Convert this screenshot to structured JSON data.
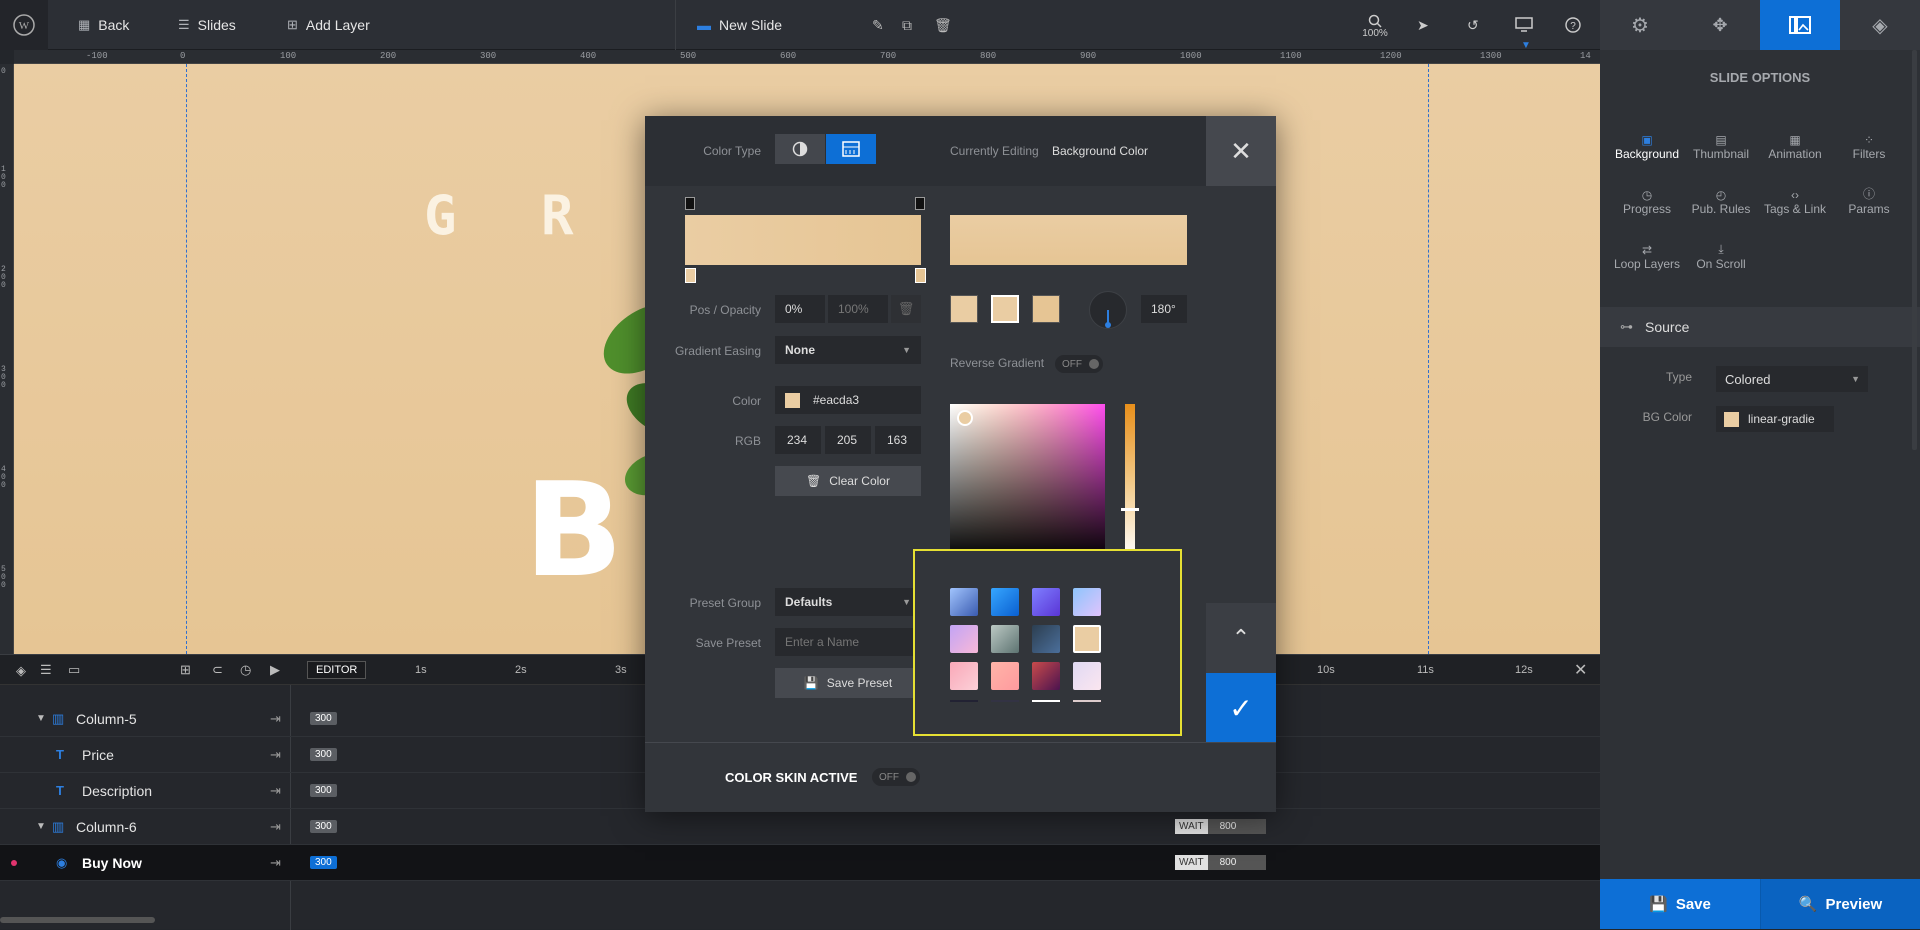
{
  "topbar": {
    "back": "Back",
    "slides": "Slides",
    "add_layer": "Add Layer",
    "slide_name": "New Slide",
    "zoom": "100%"
  },
  "ruler": {
    "h_labels": [
      "-100",
      "0",
      "100",
      "200",
      "300",
      "400",
      "500",
      "600",
      "700",
      "800",
      "900",
      "1000",
      "1100",
      "1200",
      "1300",
      "14"
    ],
    "v_labels": [
      "0",
      "1 0 0",
      "2 0 0",
      "3 0 0",
      "4 0 0",
      "5 0 0"
    ]
  },
  "canvas": {
    "heading": "G R O W",
    "big_text": "B A"
  },
  "timeline": {
    "editor": "EDITOR",
    "ticks": [
      "1s",
      "2s",
      "3s",
      "10s",
      "11s",
      "12s"
    ],
    "layers": [
      {
        "name": "Column-5",
        "badge": "300"
      },
      {
        "name": "Price",
        "badge": "300"
      },
      {
        "name": "Description",
        "badge": "300"
      },
      {
        "name": "Column-6",
        "badge": "300",
        "wait": "WAIT",
        "dur": "800"
      },
      {
        "name": "Buy Now",
        "badge": "300",
        "wait": "WAIT",
        "dur": "800"
      }
    ]
  },
  "sidebar": {
    "title": "SLIDE OPTIONS",
    "options": [
      {
        "label": "Background",
        "icon": "image-icon"
      },
      {
        "label": "Thumbnail",
        "icon": "thumbnail-icon"
      },
      {
        "label": "Animation",
        "icon": "film-icon"
      },
      {
        "label": "Filters",
        "icon": "filters-icon"
      },
      {
        "label": "Progress",
        "icon": "stopwatch-icon"
      },
      {
        "label": "Pub. Rules",
        "icon": "clock-icon"
      },
      {
        "label": "Tags & Link",
        "icon": "code-icon"
      },
      {
        "label": "Params",
        "icon": "info-icon"
      },
      {
        "label": "Loop Layers",
        "icon": "loop-icon"
      },
      {
        "label": "On Scroll",
        "icon": "scroll-icon"
      }
    ],
    "source_title": "Source",
    "type_label": "Type",
    "type_value": "Colored",
    "bgcolor_label": "BG Color",
    "bgcolor_value": "linear-gradie"
  },
  "buttons": {
    "save": "Save",
    "preview": "Preview"
  },
  "modal": {
    "color_type_label": "Color Type",
    "currently_editing_label": "Currently Editing",
    "currently_editing_value": "Background Color",
    "pos_opacity_label": "Pos / Opacity",
    "pos_value": "0%",
    "opacity_value": "100%",
    "gradient_easing_label": "Gradient Easing",
    "gradient_easing_value": "None",
    "reverse_gradient_label": "Reverse Gradient",
    "reverse_toggle": "OFF",
    "angle": "180°",
    "color_label": "Color",
    "color_hex": "#eacda3",
    "rgb_label": "RGB",
    "r": "234",
    "g": "205",
    "b": "163",
    "clear_color": "Clear Color",
    "preset_group_label": "Preset Group",
    "preset_group_value": "Defaults",
    "save_preset_label": "Save Preset",
    "save_preset_placeholder": "Enter a Name",
    "save_preset_button": "Save Preset",
    "color_skin_label": "COLOR SKIN ACTIVE",
    "color_skin_toggle": "OFF"
  },
  "colors": {
    "accent": "#0d6fd6",
    "gradient_start": "#eacda3",
    "gradient_end": "#e6c594",
    "highlight": "#e6e033"
  }
}
